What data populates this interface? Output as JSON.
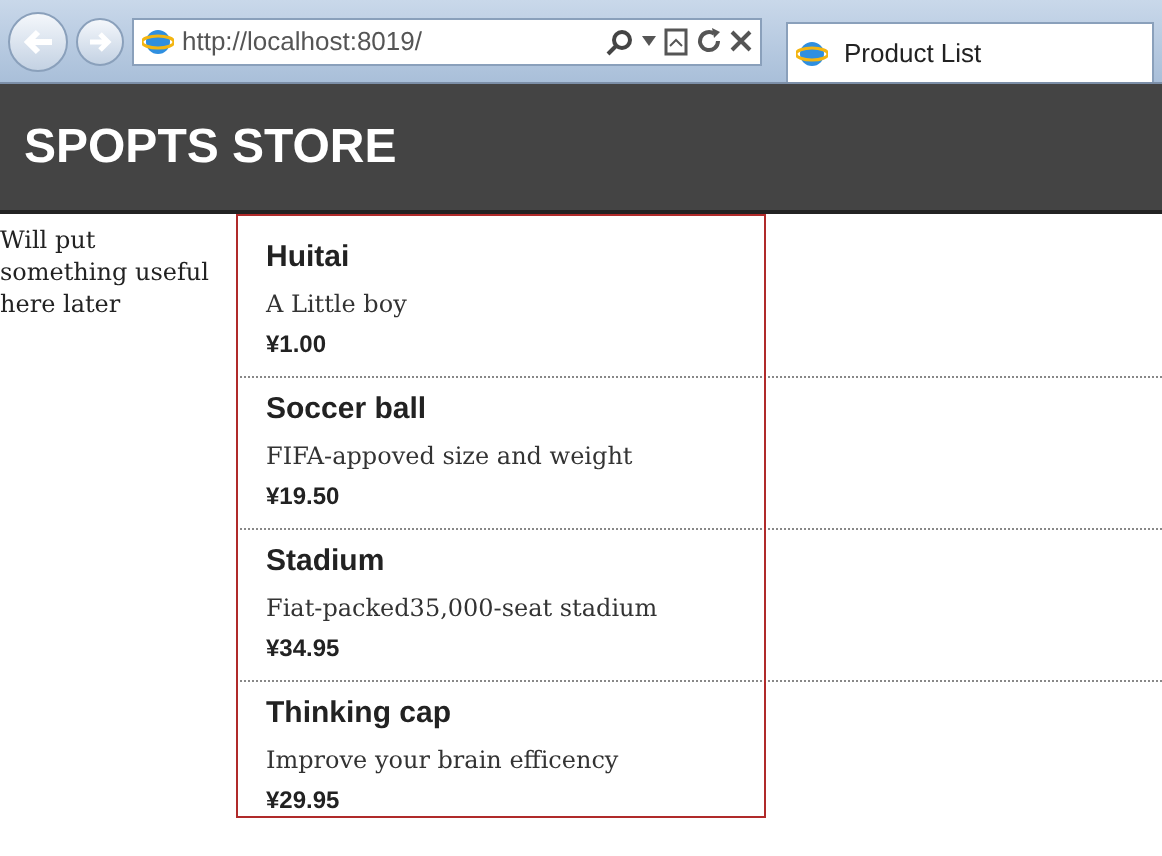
{
  "browser": {
    "url": "http://localhost:8019/",
    "tab": {
      "title": "Product List",
      "selected": true
    }
  },
  "header": {
    "title": "SPOPTS STORE"
  },
  "sidebar": {
    "text": "Will put something useful here later"
  },
  "products": [
    {
      "name": "Huitai",
      "description": "A Little boy",
      "price": "¥1.00"
    },
    {
      "name": "Soccer ball",
      "description": "FIFA-appoved size and weight",
      "price": "¥19.50"
    },
    {
      "name": "Stadium",
      "description": "Fiat-packed35,000-seat stadium",
      "price": "¥34.95"
    },
    {
      "name": "Thinking cap",
      "description": "Improve your brain efficency",
      "price": "¥29.95"
    }
  ]
}
